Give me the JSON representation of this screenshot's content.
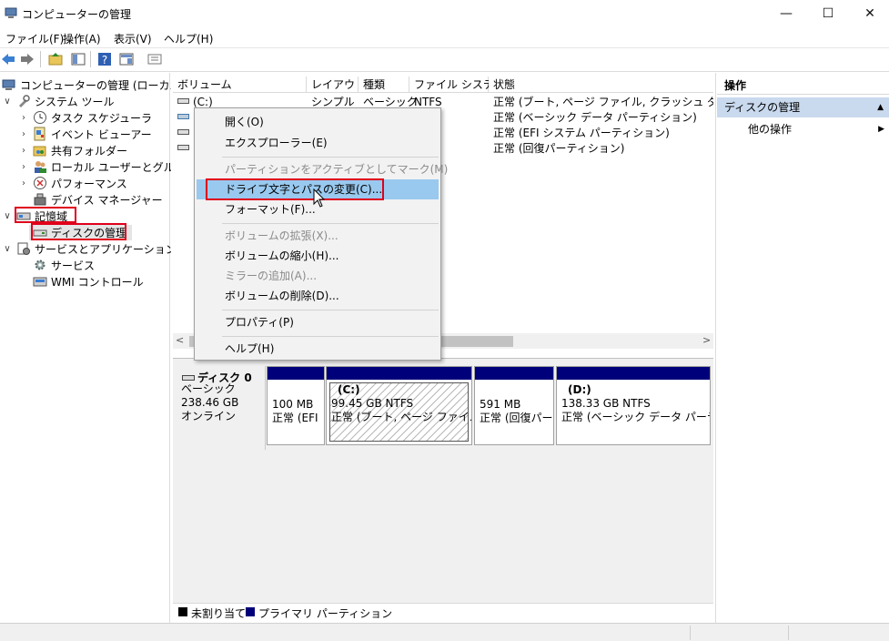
{
  "window": {
    "title": "コンピューターの管理",
    "minimize_glyph": "—",
    "maximize_glyph": "☐",
    "close_glyph": "✕"
  },
  "menu": [
    "ファイル(F)",
    "操作(A)",
    "表示(V)",
    "ヘルプ(H)"
  ],
  "toolbar": {
    "icons": [
      "back-icon",
      "forward-icon",
      "up-folder-icon",
      "show-hide-tree-icon",
      "help-icon",
      "properties-icon",
      "view-icon"
    ]
  },
  "tree": {
    "root": "コンピューターの管理 (ローカル)",
    "items": [
      {
        "label": "システム ツール",
        "chevron": "∨"
      },
      {
        "label": "タスク スケジューラ",
        "chevron": "›"
      },
      {
        "label": "イベント ビューアー",
        "chevron": "›"
      },
      {
        "label": "共有フォルダー",
        "chevron": "›"
      },
      {
        "label": "ローカル ユーザーとグループ",
        "chevron": "›"
      },
      {
        "label": "パフォーマンス",
        "chevron": "›"
      },
      {
        "label": "デバイス マネージャー",
        "chevron": ""
      },
      {
        "label": "記憶域",
        "chevron": "∨"
      },
      {
        "label": "ディスクの管理",
        "chevron": ""
      },
      {
        "label": "サービスとアプリケーション",
        "chevron": "∨"
      },
      {
        "label": "サービス",
        "chevron": ""
      },
      {
        "label": "WMI コントロール",
        "chevron": ""
      }
    ]
  },
  "volume_table": {
    "columns": [
      "ボリューム",
      "レイアウト",
      "種類",
      "ファイル システム",
      "状態"
    ],
    "rows": [
      {
        "volume": "(C:)",
        "layout": "シンプル",
        "type": "ベーシック",
        "fs": "NTFS",
        "status": "正常 (ブート, ページ ファイル, クラッシュ ダンプ, ベーシ"
      },
      {
        "volume": "",
        "layout": "",
        "type": "",
        "fs": "",
        "status": "正常 (ベーシック データ パーティション)"
      },
      {
        "volume": "",
        "layout": "",
        "type": "",
        "fs": "",
        "status": "正常 (EFI システム パーティション)"
      },
      {
        "volume": "",
        "layout": "",
        "type": "",
        "fs": "",
        "status": "正常 (回復パーティション)"
      }
    ]
  },
  "context_menu": {
    "items": [
      {
        "label": "開く(O)",
        "disabled": false
      },
      {
        "label": "エクスプローラー(E)",
        "disabled": false
      },
      {
        "label": "パーティションをアクティブとしてマーク(M)",
        "disabled": true
      },
      {
        "label": "ドライブ文字とパスの変更(C)...",
        "disabled": false,
        "highlighted": true
      },
      {
        "label": "フォーマット(F)...",
        "disabled": false
      },
      {
        "label": "ボリュームの拡張(X)...",
        "disabled": true
      },
      {
        "label": "ボリュームの縮小(H)...",
        "disabled": false
      },
      {
        "label": "ミラーの追加(A)...",
        "disabled": true
      },
      {
        "label": "ボリュームの削除(D)...",
        "disabled": false
      },
      {
        "label": "プロパティ(P)",
        "disabled": false
      },
      {
        "label": "ヘルプ(H)",
        "disabled": false
      }
    ]
  },
  "disk": {
    "name": "ディスク 0",
    "kind": "ベーシック",
    "size": "238.46 GB",
    "state": "オンライン",
    "partitions": [
      {
        "title": "",
        "size": "100 MB",
        "status": "正常 (EFI"
      },
      {
        "title": "(C:)",
        "size": "99.45 GB NTFS",
        "status": "正常 (ブート, ページ ファイル, クラ"
      },
      {
        "title": "",
        "size": "591 MB",
        "status": "正常 (回復パー"
      },
      {
        "title": "(D:)",
        "size": "138.33 GB NTFS",
        "status": "正常 (ベーシック データ パーティシ"
      }
    ]
  },
  "legend": {
    "unallocated": "未割り当て",
    "primary": "プライマリ パーティション"
  },
  "actions": {
    "header": "操作",
    "section": "ディスクの管理",
    "more": "他の操作"
  },
  "colors": {
    "selection": "#99c9ef",
    "partition_bar": "#00007a",
    "highlight_box": "#e0001a",
    "actions_section_bg": "#c9d9ee"
  }
}
